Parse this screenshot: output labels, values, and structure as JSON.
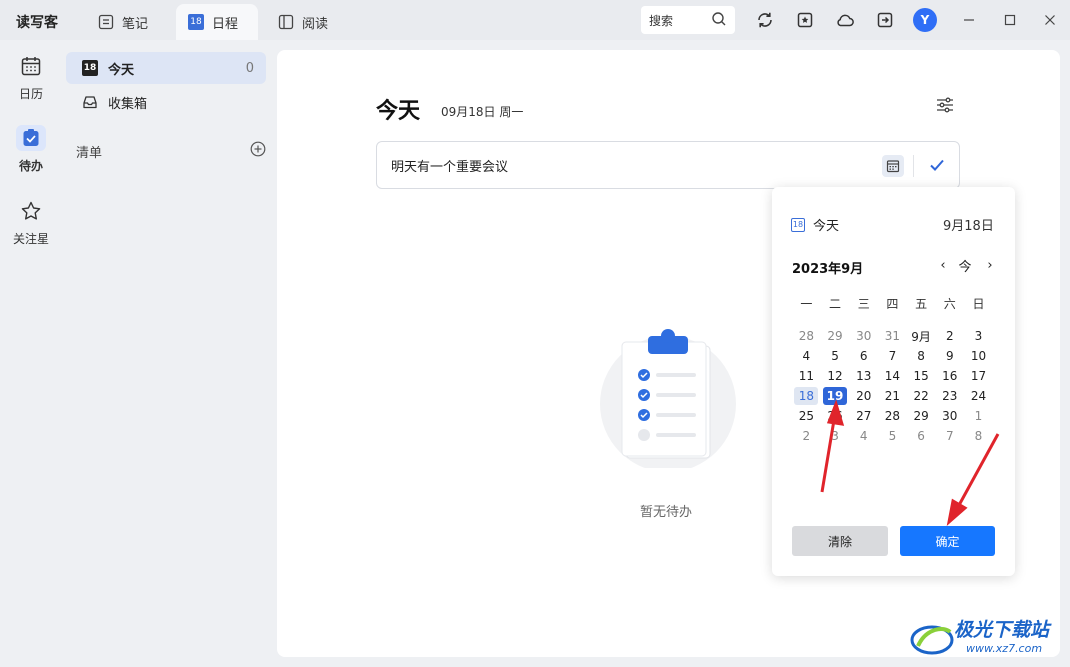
{
  "app": {
    "title": "读写客"
  },
  "tabs": [
    {
      "label": "笔记",
      "icon": "note-icon"
    },
    {
      "label": "日程",
      "icon": "calendar-badge-icon",
      "badge": "18",
      "active": true
    },
    {
      "label": "阅读",
      "icon": "book-icon"
    }
  ],
  "toolbar": {
    "search_label": "搜索",
    "avatar_letter": "Y"
  },
  "rail": [
    {
      "label": "日历",
      "icon": "calendar-icon"
    },
    {
      "label": "待办",
      "icon": "todo-check-icon",
      "active": true
    },
    {
      "label": "关注星",
      "icon": "star-icon"
    }
  ],
  "sidebar": {
    "items": [
      {
        "label": "今天",
        "badge": "18",
        "count": "0",
        "active": true
      },
      {
        "label": "收集箱"
      }
    ],
    "list_header": "清单"
  },
  "main": {
    "title": "今天",
    "date": "09月18日 周一",
    "input_value": "明天有一个重要会议",
    "empty_text": "暂无待办"
  },
  "popup": {
    "today_label": "今天",
    "today_badge": "18",
    "today_date": "9月18日",
    "month_label": "2023年9月",
    "nav_prev": "‹",
    "nav_today": "今",
    "nav_next": "›",
    "weekdays": [
      "一",
      "二",
      "三",
      "四",
      "五",
      "六",
      "日"
    ],
    "weeks": [
      [
        "28",
        "29",
        "30",
        "31",
        "9月",
        "2",
        "3"
      ],
      [
        "4",
        "5",
        "6",
        "7",
        "8",
        "9",
        "10"
      ],
      [
        "11",
        "12",
        "13",
        "14",
        "15",
        "16",
        "17"
      ],
      [
        "18",
        "19",
        "20",
        "21",
        "22",
        "23",
        "24"
      ],
      [
        "25",
        "26",
        "27",
        "28",
        "29",
        "30",
        "1"
      ],
      [
        "2",
        "3",
        "4",
        "5",
        "6",
        "7",
        "8"
      ]
    ],
    "today_day": "18",
    "selected_day": "19",
    "clear_label": "清除",
    "ok_label": "确定"
  },
  "watermark": {
    "name": "极光下载站",
    "url": "www.xz7.com"
  },
  "colors": {
    "accent": "#2f66d8",
    "primary_button": "#1677ff",
    "arrow": "#e0242b"
  }
}
